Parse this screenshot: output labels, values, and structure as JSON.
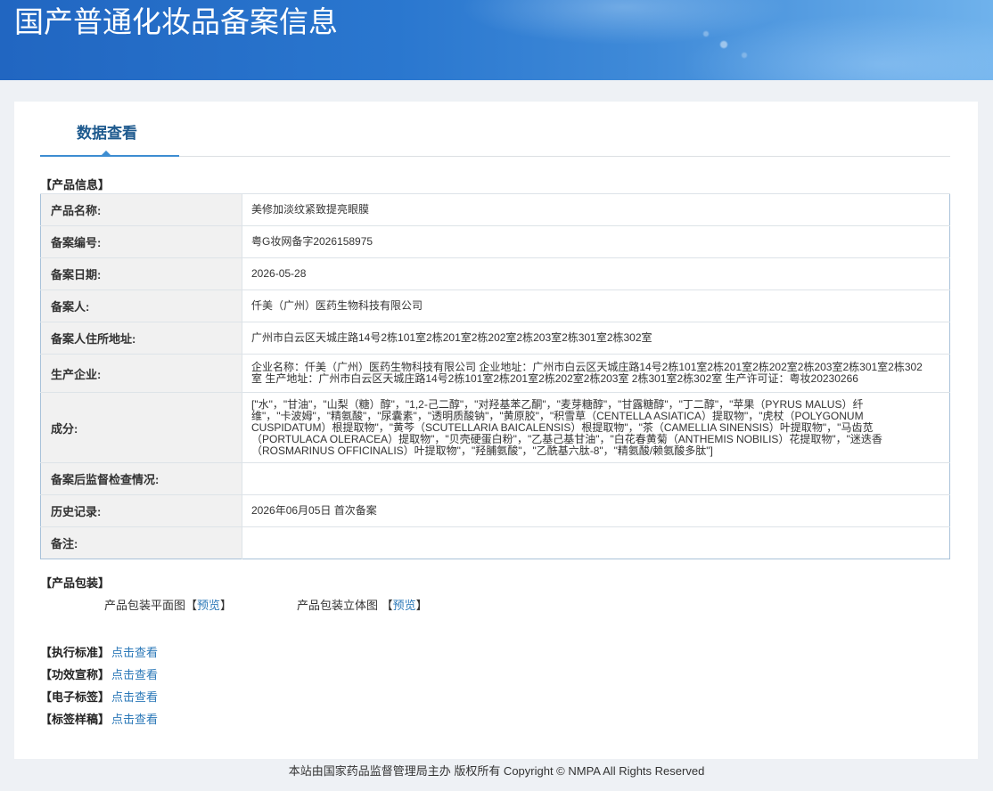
{
  "theme": {
    "header_start": "#2166c1",
    "header_end": "#6fb2ec",
    "accent": "#3d8dd1",
    "link": "#2b78b8",
    "tab_text": "#1e5a8e"
  },
  "header": {
    "title": "国产普通化妆品备案信息"
  },
  "tabs": [
    {
      "label": "数据查看",
      "active": true
    }
  ],
  "product_info": {
    "section_title": "【产品信息】",
    "rows": [
      {
        "label": "产品名称:",
        "value": "美修加淡纹紧致提亮眼膜"
      },
      {
        "label": "备案编号:",
        "value": "粤G妆网备字2026158975"
      },
      {
        "label": "备案日期:",
        "value": "2026-05-28"
      },
      {
        "label": "备案人:",
        "value": "仟美（广州）医药生物科技有限公司"
      },
      {
        "label": "备案人住所地址:",
        "value": "广州市白云区天城庄路14号2栋101室2栋201室2栋202室2栋203室2栋301室2栋302室"
      },
      {
        "label": "生产企业:",
        "value": "企业名称：仟美（广州）医药生物科技有限公司 企业地址：广州市白云区天城庄路14号2栋101室2栋201室2栋202室2栋203室2栋301室2栋302室 生产地址：广州市白云区天城庄路14号2栋101室2栋201室2栋202室2栋203室 2栋301室2栋302室 生产许可证：粤妆20230266"
      },
      {
        "label": "成分:",
        "value": "[\"水\"，\"甘油\"，\"山梨（糖）醇\"，\"1,2-己二醇\"，\"对羟基苯乙酮\"，\"麦芽糖醇\"，\"甘露糖醇\"，\"丁二醇\"，\"苹果（PYRUS MALUS）纤维\"，\"卡波姆\"，\"精氨酸\"，\"尿囊素\"，\"透明质酸钠\"，\"黄原胶\"，\"积雪草（CENTELLA ASIATICA）提取物\"，\"虎杖（POLYGONUM CUSPIDATUM）根提取物\"，\"黄芩（SCUTELLARIA BAICALENSIS）根提取物\"，\"茶（CAMELLIA SINENSIS）叶提取物\"，\"马齿苋（PORTULACA OLERACEA）提取物\"，\"贝壳硬蛋白粉\"，\"乙基己基甘油\"，\"白花春黄菊（ANTHEMIS NOBILIS）花提取物\"，\"迷迭香（ROSMARINUS OFFICINALIS）叶提取物\"，\"羟脯氨酸\"，\"乙酰基六肽-8\"，\"精氨酸/赖氨酸多肽\"]"
      },
      {
        "label": "备案后监督检查情况:",
        "value": ""
      },
      {
        "label": "历史记录:",
        "value": "2026年06月05日 首次备案"
      },
      {
        "label": "备注:",
        "value": ""
      }
    ]
  },
  "product_packaging": {
    "section_title": "【产品包装】",
    "items": [
      {
        "label": "产品包装平面图",
        "prefix": "【",
        "link": "预览",
        "suffix": "】"
      },
      {
        "label": "产品包装立体图",
        "prefix": " 【",
        "link": "预览",
        "suffix": "】"
      }
    ]
  },
  "documents": [
    {
      "label": "【执行标准】",
      "link": "点击查看"
    },
    {
      "label": "【功效宣称】",
      "link": "点击查看"
    },
    {
      "label": "【电子标签】",
      "link": "点击查看"
    },
    {
      "label": "【标签样稿】",
      "link": "点击查看"
    }
  ],
  "footer": {
    "text": "本站由国家药品监督管理局主办 版权所有 Copyright © NMPA All Rights Reserved"
  }
}
